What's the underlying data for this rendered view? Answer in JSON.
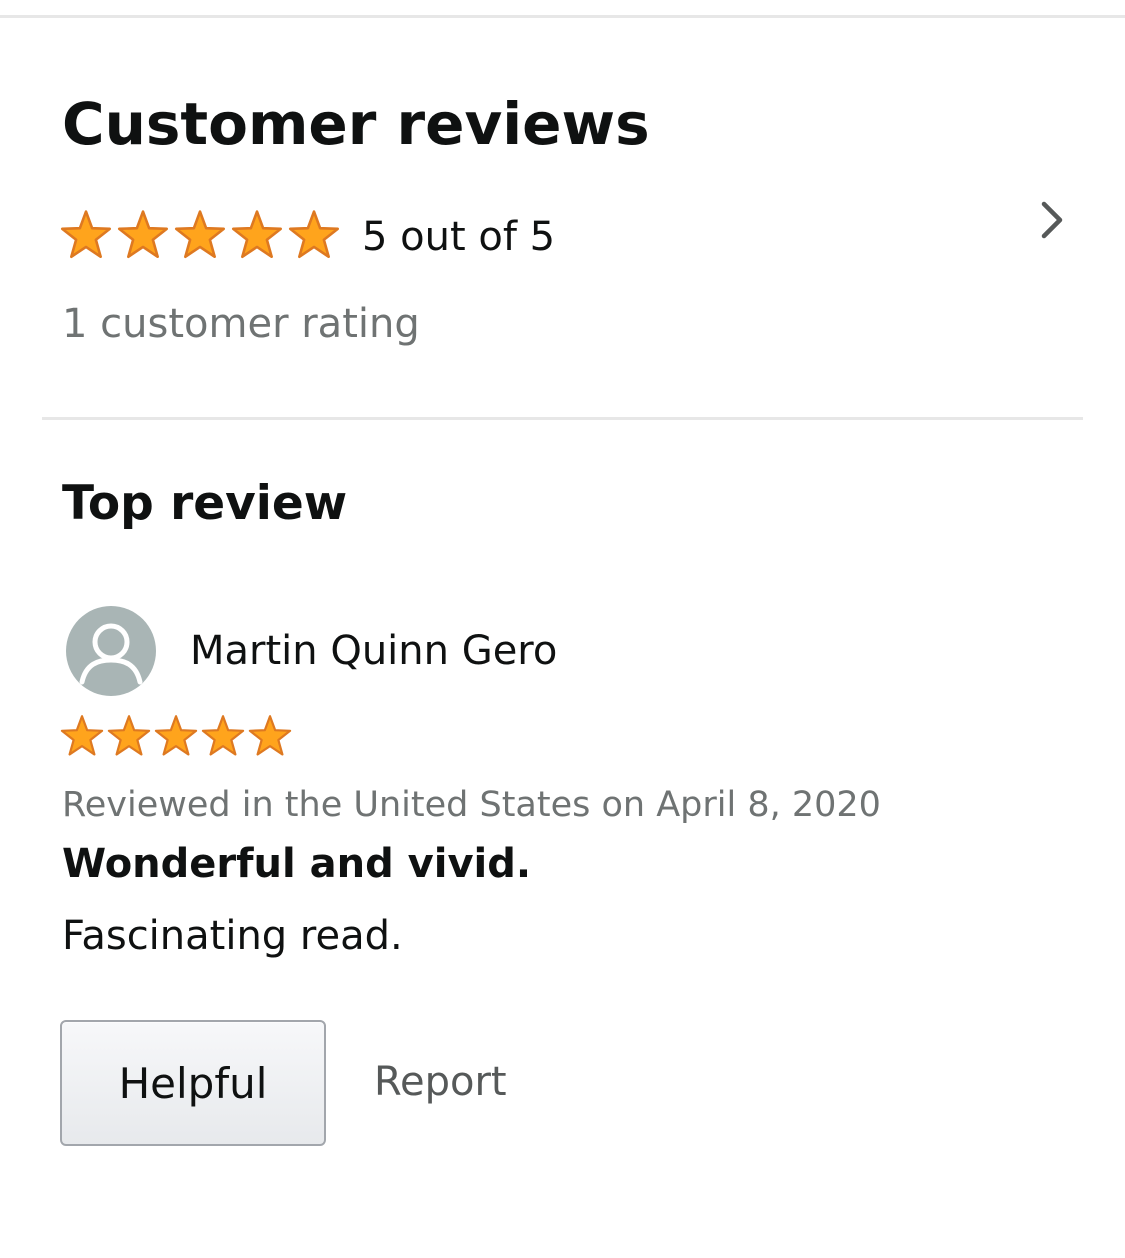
{
  "header": {
    "title": "Customer reviews"
  },
  "summary": {
    "rating_text": "5 out of 5",
    "rating_value": 5,
    "rating_max": 5,
    "count_text": "1 customer rating"
  },
  "top_review": {
    "section_title": "Top review",
    "reviewer_name": "Martin Quinn Gero",
    "rating_value": 5,
    "meta": "Reviewed in the United States on April 8, 2020",
    "headline": "Wonderful and vivid.",
    "body": "Fascinating read."
  },
  "actions": {
    "helpful_label": "Helpful",
    "report_label": "Report"
  },
  "colors": {
    "star_fill": "#ffa41c",
    "star_stroke": "#de7921",
    "secondary_text": "#6f7373",
    "avatar_bg": "#a9b5b5"
  },
  "icons": {
    "star": "star-icon",
    "chevron": "chevron-right-icon",
    "avatar": "person-icon"
  }
}
